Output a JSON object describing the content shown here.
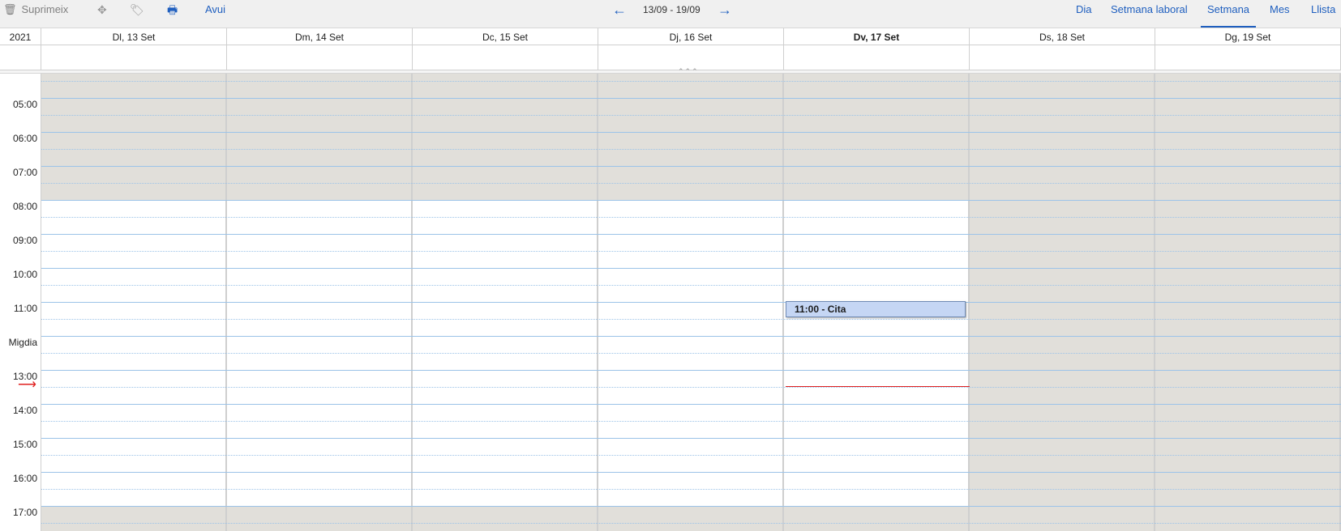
{
  "toolbar": {
    "delete_label": "Suprimeix",
    "icons": {
      "delete": "trash-icon",
      "move": "move-icon",
      "tag": "tag-icon",
      "print": "print-icon"
    },
    "today_label": "Avui",
    "range_label": "13/09 - 19/09",
    "prev": "arrow-left-icon",
    "next": "arrow-right-icon",
    "views": [
      "Dia",
      "Setmana laboral",
      "Setmana",
      "Mes",
      "Llista"
    ],
    "active_view": "Setmana"
  },
  "header": {
    "year": "2021",
    "days": [
      "Dl, 13 Set",
      "Dm, 14 Set",
      "Dc, 15 Set",
      "Dj, 16 Set",
      "Dv, 17 Set",
      "Ds, 18 Set",
      "Dg, 19 Set"
    ],
    "today": "Dv, 17 Set"
  },
  "time_labels": [
    "05:00",
    "06:00",
    "07:00",
    "08:00",
    "09:00",
    "10:00",
    "11:00",
    "Migdia",
    "13:00",
    "14:00",
    "15:00",
    "16:00",
    "17:00"
  ],
  "event": {
    "label": "11:00 - Cita"
  },
  "colors": {
    "accent": "#1f5fbf",
    "nonworking": "#e1dfda",
    "event_bg": "#c5d6f4",
    "now_line": "#e0201f",
    "grid_line": "#9cc3e8"
  }
}
